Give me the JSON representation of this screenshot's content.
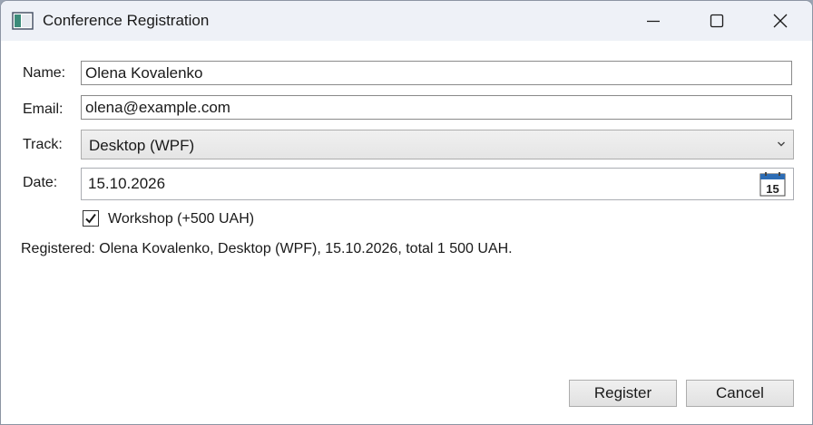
{
  "window": {
    "title": "Conference Registration",
    "icon": "window-app-icon",
    "controls": {
      "minimize_icon": "minimize-icon",
      "maximize_icon": "maximize-icon",
      "close_icon": "close-icon"
    }
  },
  "form": {
    "name": {
      "label": "Name:",
      "value": "Olena Kovalenko"
    },
    "email": {
      "label": "Email:",
      "value": "olena@example.com"
    },
    "track": {
      "label": "Track:",
      "value": "Desktop (WPF)",
      "icon": "chevron-down-icon"
    },
    "date": {
      "label": "Date:",
      "value": "15.10.2026",
      "calendar_icon": "calendar-icon",
      "calendar_day": "15"
    },
    "workshop": {
      "label": "Workshop (+500 UAH)",
      "checked": true
    }
  },
  "summary": "Registered: Olena Kovalenko, Desktop (WPF), 15.10.2026, total 1 500 UAH.",
  "buttons": {
    "register": "Register",
    "cancel": "Cancel"
  },
  "colors": {
    "titlebar": "#eef1f7",
    "window_bg": "#ffffff",
    "border": "#8a8a8a",
    "calendar_blue": "#2d6db5"
  }
}
